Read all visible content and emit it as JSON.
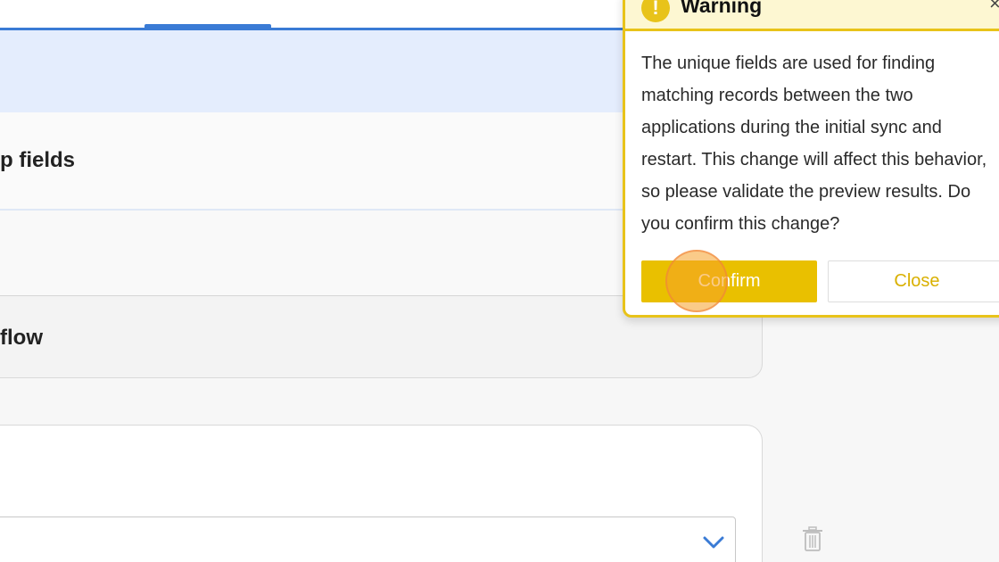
{
  "sections": {
    "lookup_title": "p fields",
    "flow_title": "flow"
  },
  "modal": {
    "title": "Warning",
    "close_glyph": "×",
    "body": "The unique fields are used for finding matching records between the two applications during the initial sync and restart. This change will affect this behavior, so please validate the preview results. Do you confirm this change?",
    "confirm_label": "Confirm",
    "close_label": "Close",
    "icon": "warning-icon"
  },
  "icons": {
    "select_chevron": "chevron-down-icon",
    "delete": "trash-icon"
  },
  "colors": {
    "accent_blue": "#3a7bd5",
    "warning_yellow": "#e8c31a",
    "banner_blue": "#e4edfd"
  }
}
